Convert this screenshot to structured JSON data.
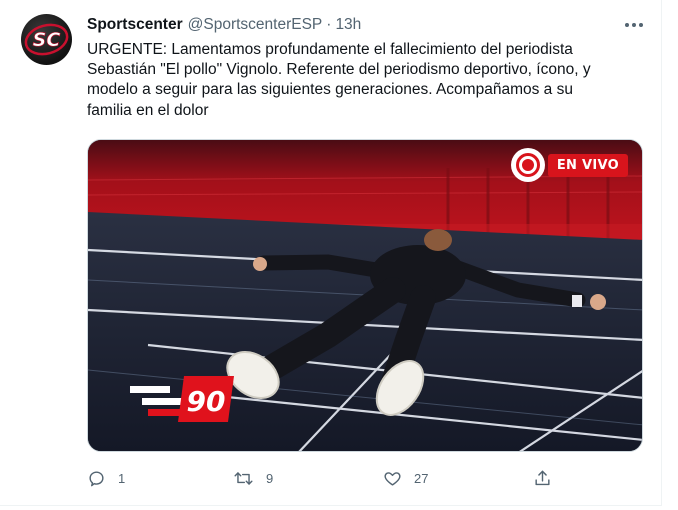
{
  "tweet": {
    "author": {
      "display_name": "Sportscenter",
      "handle": "@SportscenterESP",
      "separator": "·",
      "time": "13h",
      "avatar_logo_text": "SC"
    },
    "text": "URGENTE: Lamentamos profundamente el fallecimiento del periodista\nSebastián \"El pollo\" Vignolo. Referente del periodismo deportivo, ícono, y\nmodelo a seguir para las siguientes generaciones. Acompañamos a su\nfamilia en el dolor",
    "media": {
      "live_label": "EN VIVO",
      "scoreboard_number": "90",
      "colors": {
        "live_red": "#d8141c",
        "floor_dark": "#1a1e2e",
        "wall_red": "#b3111a"
      }
    },
    "actions": {
      "reply": {
        "icon": "reply-icon",
        "count": "1"
      },
      "retweet": {
        "icon": "retweet-icon",
        "count": "9"
      },
      "like": {
        "icon": "heart-icon",
        "count": "27"
      },
      "share": {
        "icon": "share-icon",
        "count": ""
      }
    }
  },
  "theme": {
    "text_primary": "#0f1419",
    "text_secondary": "#536471",
    "border": "#cfd9de"
  }
}
